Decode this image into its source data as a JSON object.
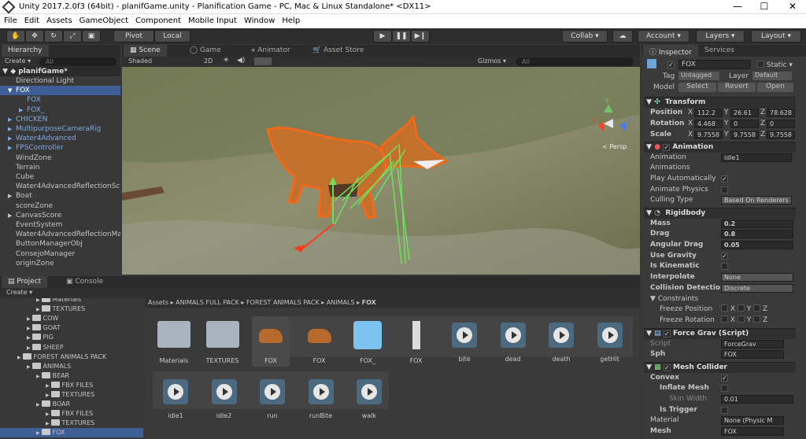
{
  "window": {
    "title": "Unity 2017.2.0f3 (64bit) - planifGame.unity - Planification Game - PC, Mac & Linux Standalone* <DX11>",
    "minimize": "—",
    "maximize": "☐",
    "close": "✕"
  },
  "menu": [
    "File",
    "Edit",
    "Assets",
    "GameObject",
    "Component",
    "Mobile Input",
    "Window",
    "Help"
  ],
  "toolbar": {
    "pivot": "Pivot",
    "local": "Local",
    "collab": "Collab ▾",
    "account": "Account ▾",
    "layers": "Layers ▾",
    "layout": "Layout ▾"
  },
  "hierarchy": {
    "tab": "Hierarchy",
    "create": "Create ▾",
    "search": "All",
    "scene": "planifGame*",
    "items": [
      {
        "label": "Directional Light",
        "indent": 1,
        "style": "normal",
        "arrow": ""
      },
      {
        "label": "FOX",
        "indent": 1,
        "style": "blue",
        "arrow": "▼"
      },
      {
        "label": "FOX",
        "indent": 2,
        "style": "blue",
        "arrow": ""
      },
      {
        "label": "FOX_",
        "indent": 2,
        "style": "blue",
        "arrow": "▶"
      },
      {
        "label": "CHICKEN",
        "indent": 1,
        "style": "blue",
        "arrow": "▶"
      },
      {
        "label": "MultipurposeCameraRig",
        "indent": 1,
        "style": "blue",
        "arrow": "▶"
      },
      {
        "label": "Water4Advanced",
        "indent": 1,
        "style": "blue",
        "arrow": "▶"
      },
      {
        "label": "FPSController",
        "indent": 1,
        "style": "blue",
        "arrow": "▶"
      },
      {
        "label": "WindZone",
        "indent": 1,
        "style": "normal",
        "arrow": ""
      },
      {
        "label": "Terrain",
        "indent": 1,
        "style": "normal",
        "arrow": ""
      },
      {
        "label": "Cube",
        "indent": 1,
        "style": "normal",
        "arrow": ""
      },
      {
        "label": "Water4AdvancedReflectionSce",
        "indent": 1,
        "style": "normal",
        "arrow": ""
      },
      {
        "label": "Boat",
        "indent": 1,
        "style": "normal",
        "arrow": "▶"
      },
      {
        "label": "scoreZone",
        "indent": 1,
        "style": "normal",
        "arrow": ""
      },
      {
        "label": "CanvasScore",
        "indent": 1,
        "style": "normal",
        "arrow": "▶"
      },
      {
        "label": "EventSystem",
        "indent": 1,
        "style": "normal",
        "arrow": ""
      },
      {
        "label": "Water4AdvancedReflectionMa",
        "indent": 1,
        "style": "normal",
        "arrow": ""
      },
      {
        "label": "ButtonManagerObj",
        "indent": 1,
        "style": "normal",
        "arrow": ""
      },
      {
        "label": "ConsejoManager",
        "indent": 1,
        "style": "normal",
        "arrow": ""
      },
      {
        "label": "originZone",
        "indent": 1,
        "style": "normal",
        "arrow": ""
      }
    ]
  },
  "scene": {
    "tabs": [
      "Scene",
      "Game",
      "Animator",
      "Asset Store"
    ],
    "shaded": "Shaded",
    "mode2d": "2D",
    "gizmos": "Gizmos ▾",
    "search": "All",
    "persp": "< Persp",
    "axes": {
      "x": "x",
      "y": "y",
      "z": "z"
    }
  },
  "project": {
    "tabs": [
      "Project",
      "Console"
    ],
    "create": "Create ▾",
    "tree": [
      {
        "label": "Materials",
        "indent": 3
      },
      {
        "label": "TEXTURES",
        "indent": 3
      },
      {
        "label": "COW",
        "indent": 2
      },
      {
        "label": "GOAT",
        "indent": 2
      },
      {
        "label": "PIG",
        "indent": 2
      },
      {
        "label": "SHEEP",
        "indent": 2
      },
      {
        "label": "FOREST ANIMALS PACK",
        "indent": 1
      },
      {
        "label": "ANIMALS",
        "indent": 2
      },
      {
        "label": "BEAR",
        "indent": 3
      },
      {
        "label": "FBX FILES",
        "indent": 4
      },
      {
        "label": "TEXTURES",
        "indent": 4
      },
      {
        "label": "BOAR",
        "indent": 3
      },
      {
        "label": "FBX FILES",
        "indent": 4
      },
      {
        "label": "TEXTURES",
        "indent": 4
      },
      {
        "label": "FOX",
        "indent": 3
      }
    ],
    "breadcrumb": [
      "Assets",
      "ANIMALS FULL PACK",
      "FOREST ANIMALS PACK",
      "ANIMALS",
      "FOX"
    ],
    "assets_row1": [
      {
        "label": "Materials",
        "kind": "folder"
      },
      {
        "label": "TEXTURES",
        "kind": "folder"
      },
      {
        "label": "FOX",
        "kind": "model"
      },
      {
        "label": "FOX",
        "kind": "fox"
      },
      {
        "label": "FOX_",
        "kind": "prefab"
      },
      {
        "label": "FOX",
        "kind": "avatar"
      },
      {
        "label": "bite",
        "kind": "anim"
      },
      {
        "label": "dead",
        "kind": "anim"
      },
      {
        "label": "death",
        "kind": "anim"
      },
      {
        "label": "getHit",
        "kind": "anim"
      }
    ],
    "assets_row2": [
      {
        "label": "idle1",
        "kind": "anim"
      },
      {
        "label": "idle2",
        "kind": "anim"
      },
      {
        "label": "run",
        "kind": "anim"
      },
      {
        "label": "runBite",
        "kind": "anim"
      },
      {
        "label": "walk",
        "kind": "anim"
      }
    ]
  },
  "inspector": {
    "tabs": [
      "Inspector",
      "Services"
    ],
    "name": "FOX",
    "static": "Static ▾",
    "tag_label": "Tag",
    "tag": "Untagged",
    "layer_label": "Layer",
    "layer": "Default",
    "model_label": "Model",
    "select": "Select",
    "revert": "Revert",
    "open": "Open",
    "transform": {
      "title": "Transform",
      "rows": [
        {
          "label": "Position",
          "x": "112.2",
          "y": "26.61",
          "z": "78.628"
        },
        {
          "label": "Rotation",
          "x": "4.468",
          "y": "0",
          "z": "0"
        },
        {
          "label": "Scale",
          "x": "9.7558",
          "y": "9.7558",
          "z": "9.7558"
        }
      ]
    },
    "animation": {
      "title": "Animation",
      "clip_label": "Animation",
      "clip": "idle1",
      "anims_label": "Animations",
      "play_auto": "Play Automatically",
      "anim_physics": "Animate Physics",
      "culling_label": "Culling Type",
      "culling": "Based On Renderers"
    },
    "rigidbody": {
      "title": "Rigidbody",
      "mass_label": "Mass",
      "mass": "0.2",
      "drag_label": "Drag",
      "drag": "0.8",
      "angdrag_label": "Angular Drag",
      "angdrag": "0.05",
      "gravity": "Use Gravity",
      "kinematic": "Is Kinematic",
      "interp_label": "Interpolate",
      "interp": "None",
      "coll_label": "Collision Detection",
      "coll": "Discrete",
      "constraints": "Constraints",
      "freeze_pos": "Freeze Position",
      "freeze_rot": "Freeze Rotation",
      "xyz": [
        "X",
        "Y",
        "Z"
      ]
    },
    "forcegrav": {
      "title": "Force Grav (Script)",
      "script_label": "Script",
      "script": "ForceGrav",
      "sph_label": "Sph",
      "sph": "FOX"
    },
    "meshcollider": {
      "title": "Mesh Collider",
      "convex": "Convex",
      "inflate": "Inflate Mesh",
      "skin_label": "Skin Width",
      "skin": "0.01",
      "trigger": "Is Trigger",
      "material_label": "Material",
      "material": "None (Physic M",
      "mesh_label": "Mesh",
      "mesh": "FOX"
    }
  }
}
